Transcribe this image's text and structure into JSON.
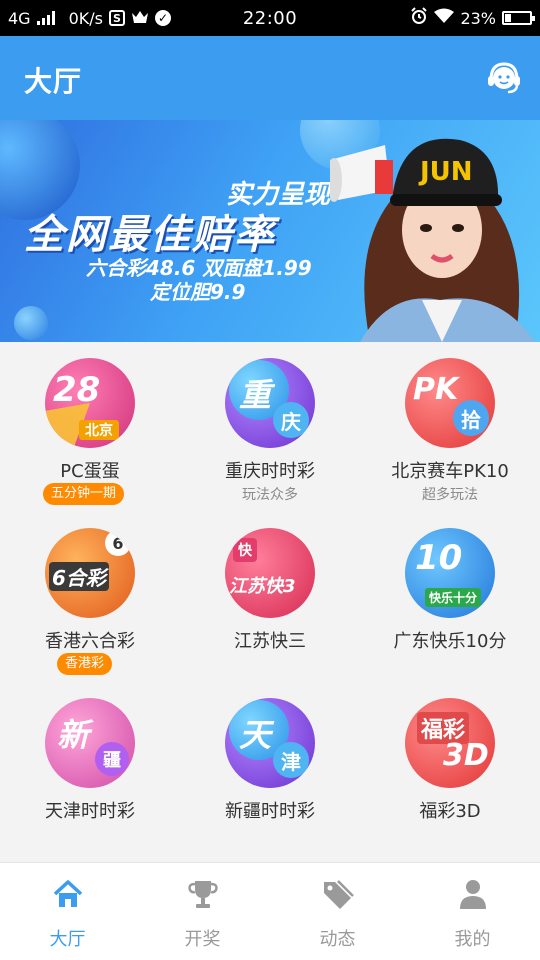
{
  "status_bar": {
    "network": "4G",
    "speed": "0K/s",
    "time": "22:00",
    "battery": "23%"
  },
  "header": {
    "title": "大厅"
  },
  "banner": {
    "line1": "实力呈现",
    "line2": "全网最佳赔率",
    "line3": "六合彩48.6  双面盘1.99",
    "line4": "定位胆9.9",
    "cap_text": "JUN"
  },
  "games": [
    {
      "name": "PC蛋蛋",
      "tag": "五分钟一期",
      "badge_main": "28",
      "badge_sub": "北京"
    },
    {
      "name": "重庆时时彩",
      "subtitle": "玩法众多",
      "badge_main": "重",
      "badge_sub": "庆"
    },
    {
      "name": "北京赛车PK10",
      "subtitle": "超多玩法",
      "badge_main": "PK",
      "badge_sub": "拾"
    },
    {
      "name": "香港六合彩",
      "tag": "香港彩",
      "badge_main": "6合彩",
      "badge_sub": "6"
    },
    {
      "name": "江苏快三",
      "badge_main": "江苏快3",
      "badge_sub": "快"
    },
    {
      "name": "广东快乐10分",
      "badge_main": "10",
      "badge_sub": "快乐十分"
    },
    {
      "name": "天津时时彩",
      "badge_main": "新",
      "badge_sub": "疆"
    },
    {
      "name": "新疆时时彩",
      "badge_main": "天",
      "badge_sub": "津"
    },
    {
      "name": "福彩3D",
      "badge_main": "3D",
      "badge_sub": "福彩"
    }
  ],
  "tabs": [
    {
      "label": "大厅",
      "icon": "home-icon",
      "active": true
    },
    {
      "label": "开奖",
      "icon": "trophy-icon"
    },
    {
      "label": "动态",
      "icon": "tag-icon"
    },
    {
      "label": "我的",
      "icon": "person-icon"
    }
  ],
  "colors": {
    "primary": "#3b9cf0",
    "tag_orange": "#ff8a00"
  }
}
